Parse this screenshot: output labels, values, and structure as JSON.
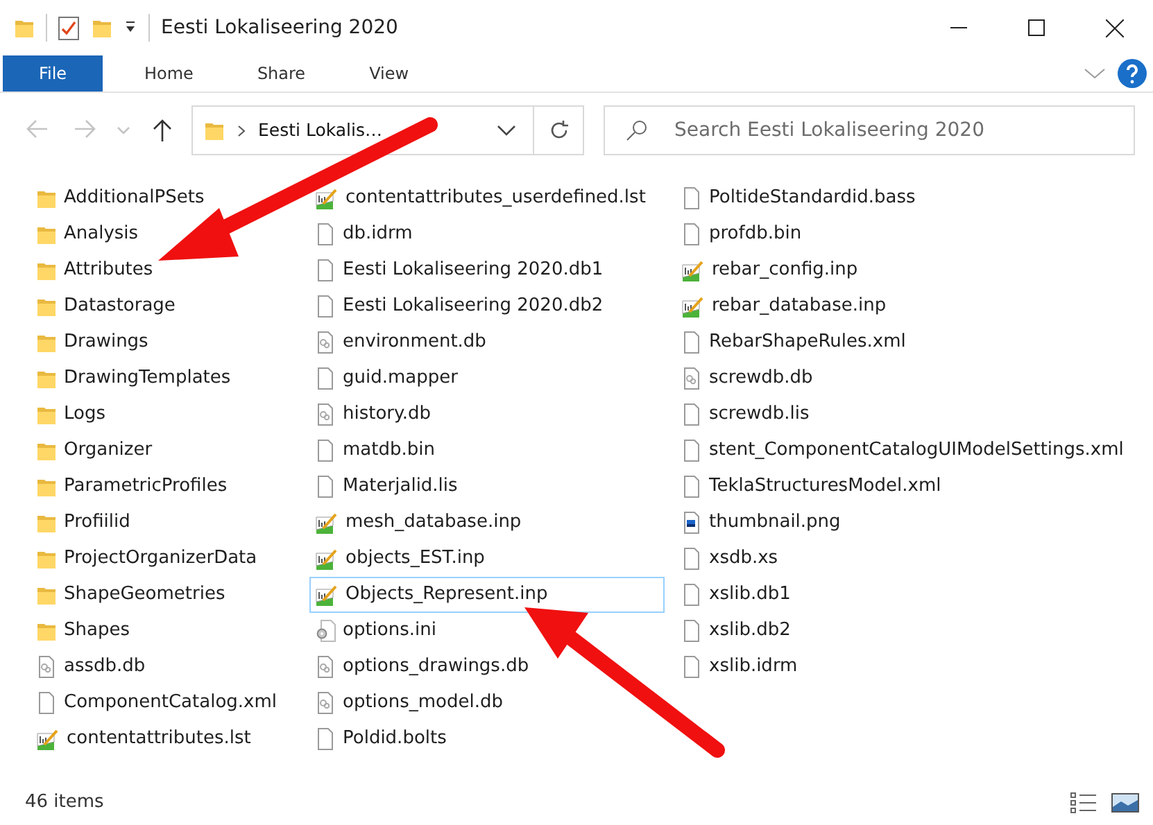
{
  "window": {
    "title": "Eesti Lokaliseering 2020"
  },
  "ribbon": {
    "tabs": [
      {
        "label": "File",
        "kind": "file_menu"
      },
      {
        "label": "Home",
        "kind": "tab"
      },
      {
        "label": "Share",
        "kind": "tab"
      },
      {
        "label": "View",
        "kind": "tab"
      }
    ]
  },
  "nav_buttons": [
    {
      "kind": "back",
      "disabled": true
    },
    {
      "kind": "forward",
      "disabled": true
    },
    {
      "kind": "recent",
      "disabled": true
    },
    {
      "kind": "up",
      "disabled": false
    }
  ],
  "address_bar": {
    "path": [
      "Eesti Lokalis…"
    ]
  },
  "search": {
    "placeholder": "Search Eesti Lokaliseering 2020"
  },
  "files": [
    {
      "name": "AdditionalPSets",
      "kind": "folder",
      "selected": false
    },
    {
      "name": "Analysis",
      "kind": "folder",
      "selected": false
    },
    {
      "name": "Attributes",
      "kind": "folder",
      "selected": false
    },
    {
      "name": "Datastorage",
      "kind": "folder",
      "selected": false
    },
    {
      "name": "Drawings",
      "kind": "folder",
      "selected": false
    },
    {
      "name": "DrawingTemplates",
      "kind": "folder",
      "selected": false
    },
    {
      "name": "Logs",
      "kind": "folder",
      "selected": false
    },
    {
      "name": "Organizer",
      "kind": "folder",
      "selected": false
    },
    {
      "name": "ParametricProfiles",
      "kind": "folder",
      "selected": false
    },
    {
      "name": "Profiilid",
      "kind": "folder",
      "selected": false
    },
    {
      "name": "ProjectOrganizerData",
      "kind": "folder",
      "selected": false
    },
    {
      "name": "ShapeGeometries",
      "kind": "folder",
      "selected": false
    },
    {
      "name": "Shapes",
      "kind": "folder",
      "selected": false
    },
    {
      "name": "assdb.db",
      "kind": "database",
      "selected": false
    },
    {
      "name": "ComponentCatalog.xml",
      "kind": "file",
      "selected": false
    },
    {
      "name": "contentattributes.lst",
      "kind": "chart",
      "selected": false
    },
    {
      "name": "contentattributes_userdefined.lst",
      "kind": "chart",
      "selected": false
    },
    {
      "name": "db.idrm",
      "kind": "file",
      "selected": false
    },
    {
      "name": "Eesti Lokaliseering 2020.db1",
      "kind": "file",
      "selected": false
    },
    {
      "name": "Eesti Lokaliseering 2020.db2",
      "kind": "file",
      "selected": false
    },
    {
      "name": "environment.db",
      "kind": "database",
      "selected": false
    },
    {
      "name": "guid.mapper",
      "kind": "file",
      "selected": false
    },
    {
      "name": "history.db",
      "kind": "database",
      "selected": false
    },
    {
      "name": "matdb.bin",
      "kind": "file",
      "selected": false
    },
    {
      "name": "Materjalid.lis",
      "kind": "file",
      "selected": false
    },
    {
      "name": "mesh_database.inp",
      "kind": "chart",
      "selected": false
    },
    {
      "name": "objects_EST.inp",
      "kind": "chart",
      "selected": false
    },
    {
      "name": "Objects_Represent.inp",
      "kind": "chart",
      "selected": true
    },
    {
      "name": "options.ini",
      "kind": "settings",
      "selected": false
    },
    {
      "name": "options_drawings.db",
      "kind": "database",
      "selected": false
    },
    {
      "name": "options_model.db",
      "kind": "database",
      "selected": false
    },
    {
      "name": "Poldid.bolts",
      "kind": "file",
      "selected": false
    },
    {
      "name": "PoltideStandardid.bass",
      "kind": "file",
      "selected": false
    },
    {
      "name": "profdb.bin",
      "kind": "file",
      "selected": false
    },
    {
      "name": "rebar_config.inp",
      "kind": "chart",
      "selected": false
    },
    {
      "name": "rebar_database.inp",
      "kind": "chart",
      "selected": false
    },
    {
      "name": "RebarShapeRules.xml",
      "kind": "file",
      "selected": false
    },
    {
      "name": "screwdb.db",
      "kind": "database",
      "selected": false
    },
    {
      "name": "screwdb.lis",
      "kind": "file",
      "selected": false
    },
    {
      "name": "stent_ComponentCatalogUIModelSettings.xml",
      "kind": "file",
      "selected": false
    },
    {
      "name": "TeklaStructuresModel.xml",
      "kind": "file",
      "selected": false
    },
    {
      "name": "thumbnail.png",
      "kind": "image",
      "selected": false
    },
    {
      "name": "xsdb.xs",
      "kind": "file",
      "selected": false
    },
    {
      "name": "xslib.db1",
      "kind": "file",
      "selected": false
    },
    {
      "name": "xslib.db2",
      "kind": "file",
      "selected": false
    },
    {
      "name": "xslib.idrm",
      "kind": "file",
      "selected": false
    }
  ],
  "status_bar": {
    "item_count": "46 items"
  }
}
